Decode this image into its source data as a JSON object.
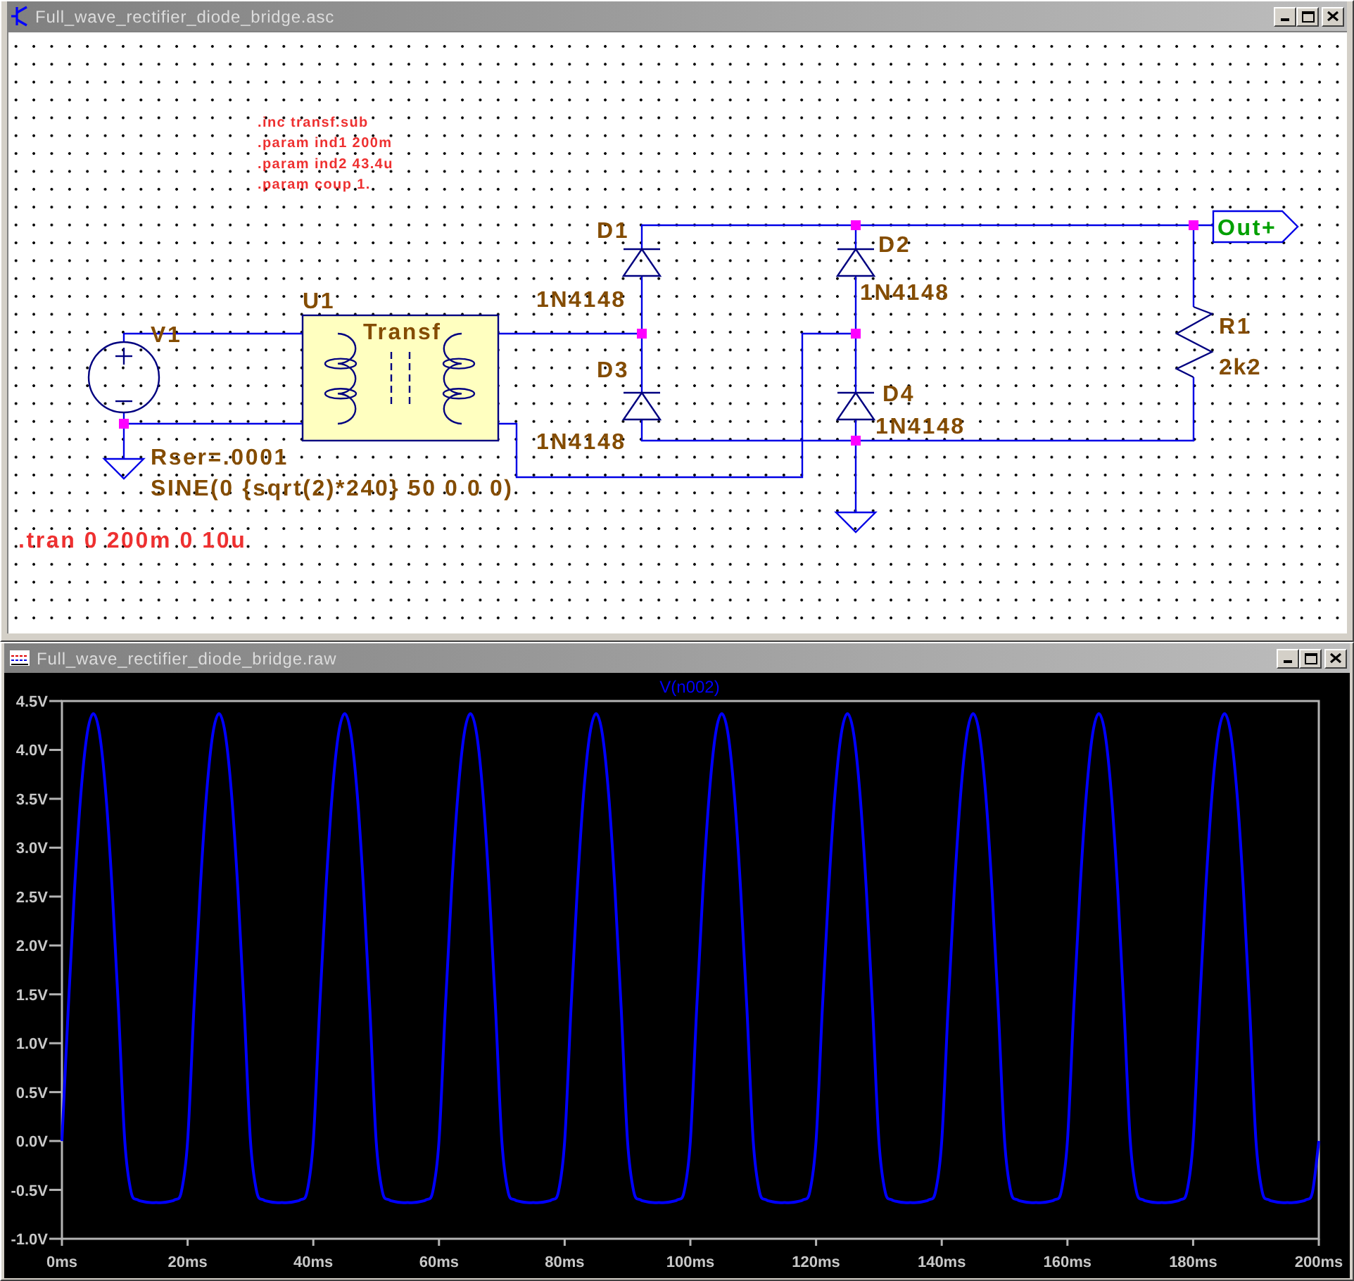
{
  "schematic_window": {
    "title": "Full_wave_rectifier_diode_bridge.asc",
    "directives": [
      ".inc transf.sub",
      ".param ind1 200m",
      ".param ind2 43.4u",
      ".param coup 1."
    ],
    "simulation_command": ".tran 0 200m 0 10u",
    "components": [
      {
        "kind": "voltage_source",
        "name": "V1",
        "values": [
          "Rser=.0001",
          "SINE(0 {sqrt(2)*240} 50 0 0 0)"
        ]
      },
      {
        "kind": "transformer",
        "name": "U1",
        "values": [
          "Transf"
        ]
      },
      {
        "kind": "diode",
        "name": "D1",
        "values": [
          "1N4148"
        ]
      },
      {
        "kind": "diode",
        "name": "D2",
        "values": [
          "1N4148"
        ]
      },
      {
        "kind": "diode",
        "name": "D3",
        "values": [
          "1N4148"
        ]
      },
      {
        "kind": "diode",
        "name": "D4",
        "values": [
          "1N4148"
        ]
      },
      {
        "kind": "resistor",
        "name": "R1",
        "values": [
          "2k2"
        ]
      }
    ],
    "net_label": "Out+"
  },
  "waveform_window": {
    "title": "Full_wave_rectifier_diode_bridge.raw",
    "chart_data": {
      "type": "line",
      "x": [
        0,
        1,
        2,
        3,
        4,
        5,
        6,
        7,
        8,
        9,
        10,
        11,
        12,
        13,
        14,
        15,
        16,
        17,
        18,
        19,
        20,
        21,
        22,
        23,
        24,
        25,
        26,
        27,
        28,
        29,
        30,
        31,
        32,
        33,
        34,
        35,
        36,
        37,
        38,
        39,
        40,
        41,
        42,
        43,
        44,
        45,
        46,
        47,
        48,
        49,
        50,
        51,
        52,
        53,
        54,
        55,
        56,
        57,
        58,
        59,
        60,
        61,
        62,
        63,
        64,
        65,
        66,
        67,
        68,
        69,
        70,
        71,
        72,
        73,
        74,
        75,
        76,
        77,
        78,
        79,
        80,
        81,
        82,
        83,
        84,
        85,
        86,
        87,
        88,
        89,
        90,
        91,
        92,
        93,
        94,
        95,
        96,
        97,
        98,
        99,
        100,
        101,
        102,
        103,
        104,
        105,
        106,
        107,
        108,
        109,
        110,
        111,
        112,
        113,
        114,
        115,
        116,
        117,
        118,
        119,
        120,
        121,
        122,
        123,
        124,
        125,
        126,
        127,
        128,
        129,
        130,
        131,
        132,
        133,
        134,
        135,
        136,
        137,
        138,
        139,
        140,
        141,
        142,
        143,
        144,
        145,
        146,
        147,
        148,
        149,
        150,
        151,
        152,
        153,
        154,
        155,
        156,
        157,
        158,
        159,
        160,
        161,
        162,
        163,
        164,
        165,
        166,
        167,
        168,
        169,
        170,
        171,
        172,
        173,
        174,
        175,
        176,
        177,
        178,
        179,
        180,
        181,
        182,
        183,
        184,
        185,
        186,
        187,
        188,
        189,
        190,
        191,
        192,
        193,
        194,
        195,
        196,
        197,
        198,
        199,
        200
      ],
      "series": [
        {
          "name": "V(n002)",
          "color": "#0000ff",
          "values": [
            0,
            1.35,
            2.57,
            3.54,
            4.16,
            4.37,
            4.16,
            3.54,
            2.57,
            1.35,
            0,
            -0.52,
            -0.6,
            -0.62,
            -0.63,
            -0.63,
            -0.63,
            -0.62,
            -0.6,
            -0.52,
            0,
            1.35,
            2.57,
            3.54,
            4.16,
            4.37,
            4.16,
            3.54,
            2.57,
            1.35,
            0,
            -0.52,
            -0.6,
            -0.62,
            -0.63,
            -0.63,
            -0.63,
            -0.62,
            -0.6,
            -0.52,
            0,
            1.35,
            2.57,
            3.54,
            4.16,
            4.37,
            4.16,
            3.54,
            2.57,
            1.35,
            0,
            -0.52,
            -0.6,
            -0.62,
            -0.63,
            -0.63,
            -0.63,
            -0.62,
            -0.6,
            -0.52,
            0,
            1.35,
            2.57,
            3.54,
            4.16,
            4.37,
            4.16,
            3.54,
            2.57,
            1.35,
            0,
            -0.52,
            -0.6,
            -0.62,
            -0.63,
            -0.63,
            -0.63,
            -0.62,
            -0.6,
            -0.52,
            0,
            1.35,
            2.57,
            3.54,
            4.16,
            4.37,
            4.16,
            3.54,
            2.57,
            1.35,
            0,
            -0.52,
            -0.6,
            -0.62,
            -0.63,
            -0.63,
            -0.63,
            -0.62,
            -0.6,
            -0.52,
            0,
            1.35,
            2.57,
            3.54,
            4.16,
            4.37,
            4.16,
            3.54,
            2.57,
            1.35,
            0,
            -0.52,
            -0.6,
            -0.62,
            -0.63,
            -0.63,
            -0.63,
            -0.62,
            -0.6,
            -0.52,
            0,
            1.35,
            2.57,
            3.54,
            4.16,
            4.37,
            4.16,
            3.54,
            2.57,
            1.35,
            0,
            -0.52,
            -0.6,
            -0.62,
            -0.63,
            -0.63,
            -0.63,
            -0.62,
            -0.6,
            -0.52,
            0,
            1.35,
            2.57,
            3.54,
            4.16,
            4.37,
            4.16,
            3.54,
            2.57,
            1.35,
            0,
            -0.52,
            -0.6,
            -0.62,
            -0.63,
            -0.63,
            -0.63,
            -0.62,
            -0.6,
            -0.52,
            0,
            1.35,
            2.57,
            3.54,
            4.16,
            4.37,
            4.16,
            3.54,
            2.57,
            1.35,
            0,
            -0.52,
            -0.6,
            -0.62,
            -0.63,
            -0.63,
            -0.63,
            -0.62,
            -0.6,
            -0.52,
            0,
            1.35,
            2.57,
            3.54,
            4.16,
            4.37,
            4.16,
            3.54,
            2.57,
            1.35,
            0,
            -0.52,
            -0.6,
            -0.62,
            -0.63,
            -0.63,
            -0.63,
            -0.62,
            -0.6,
            -0.52,
            0
          ]
        }
      ],
      "xlim": [
        0,
        200
      ],
      "ylim": [
        -1,
        4.5
      ],
      "xticks": [
        {
          "value": 0,
          "label": "0ms"
        },
        {
          "value": 20,
          "label": "20ms"
        },
        {
          "value": 40,
          "label": "40ms"
        },
        {
          "value": 60,
          "label": "60ms"
        },
        {
          "value": 80,
          "label": "80ms"
        },
        {
          "value": 100,
          "label": "100ms"
        },
        {
          "value": 120,
          "label": "120ms"
        },
        {
          "value": 140,
          "label": "140ms"
        },
        {
          "value": 160,
          "label": "160ms"
        },
        {
          "value": 180,
          "label": "180ms"
        },
        {
          "value": 200,
          "label": "200ms"
        }
      ],
      "yticks": [
        {
          "value": -1,
          "label": "-1.0V"
        },
        {
          "value": -0.5,
          "label": "-0.5V"
        },
        {
          "value": 0,
          "label": "0.0V"
        },
        {
          "value": 0.5,
          "label": "0.5V"
        },
        {
          "value": 1,
          "label": "1.0V"
        },
        {
          "value": 1.5,
          "label": "1.5V"
        },
        {
          "value": 2,
          "label": "2.0V"
        },
        {
          "value": 2.5,
          "label": "2.5V"
        },
        {
          "value": 3,
          "label": "3.0V"
        },
        {
          "value": 3.5,
          "label": "3.5V"
        },
        {
          "value": 4,
          "label": "4.0V"
        },
        {
          "value": 4.5,
          "label": "4.5V"
        }
      ]
    }
  }
}
